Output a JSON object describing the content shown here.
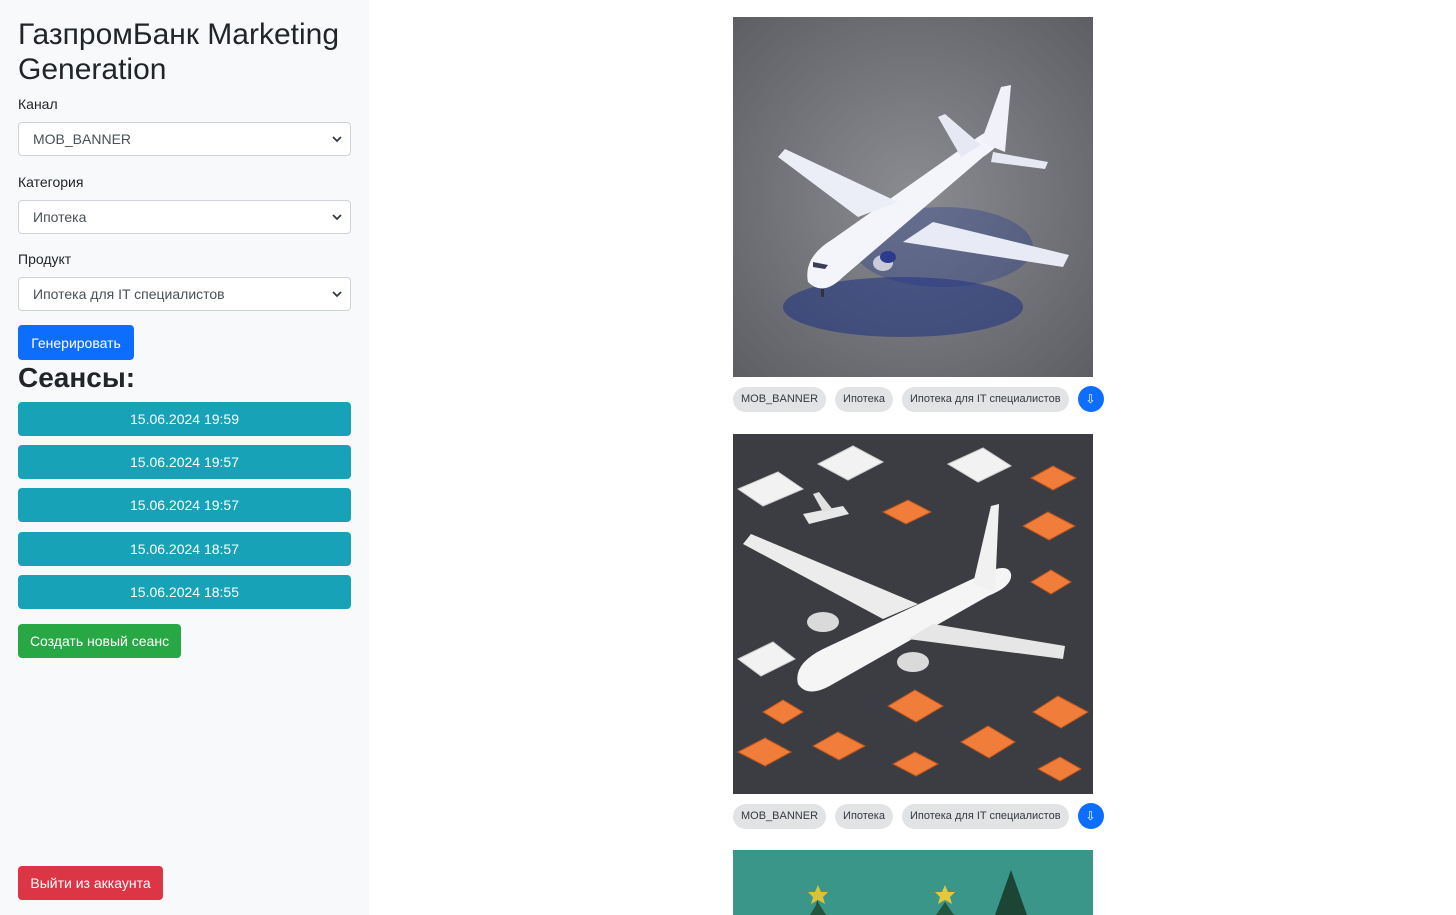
{
  "app": {
    "title": "ГазпромБанк Marketing Generation"
  },
  "form": {
    "channel_label": "Канал",
    "channel_value": "MOB_BANNER",
    "category_label": "Категория",
    "category_value": "Ипотека",
    "product_label": "Продукт",
    "product_value": "Ипотека для IT специалистов",
    "generate_label": "Генерировать"
  },
  "sessions": {
    "heading": "Сеансы:",
    "items": [
      {
        "label": "15.06.2024 19:59"
      },
      {
        "label": "15.06.2024 19:57"
      },
      {
        "label": "15.06.2024 19:57"
      },
      {
        "label": "15.06.2024 18:57"
      },
      {
        "label": "15.06.2024 18:55"
      }
    ],
    "new_label": "Создать новый сеанс"
  },
  "logout_label": "Выйти из аккаунта",
  "feed": [
    {
      "tags": [
        "MOB_BANNER",
        "Ипотека",
        "Ипотека для IT специалистов"
      ],
      "download_icon": "⇩"
    },
    {
      "tags": [
        "MOB_BANNER",
        "Ипотека",
        "Ипотека для IT специалистов"
      ],
      "download_icon": "⇩"
    }
  ],
  "colors": {
    "primary": "#0d6efd",
    "session": "#17a2b8",
    "success": "#28a745",
    "danger": "#dc3545",
    "sidebar_bg": "#f8f9fa"
  }
}
